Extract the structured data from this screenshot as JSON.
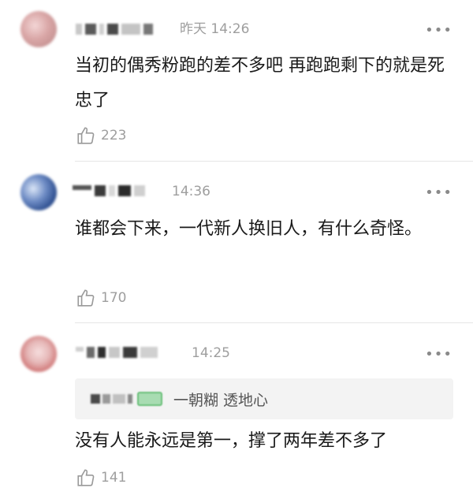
{
  "comments": [
    {
      "time": "昨天 14:26",
      "text": "当初的偶秀粉跑的差不多吧 再跑跑剩下的就是死忠了",
      "likes": "223"
    },
    {
      "time": "14:36",
      "text": "谁都会下来，一代新人换旧人，有什么奇怪。",
      "likes": "170"
    },
    {
      "time": "14:25",
      "quote_text": "一朝糊 透地心",
      "text": "没有人能永远是第一，撑了两年差不多了",
      "likes": "141"
    }
  ],
  "more_icon": "more-dots-icon",
  "like_icon": "thumb-up-icon"
}
